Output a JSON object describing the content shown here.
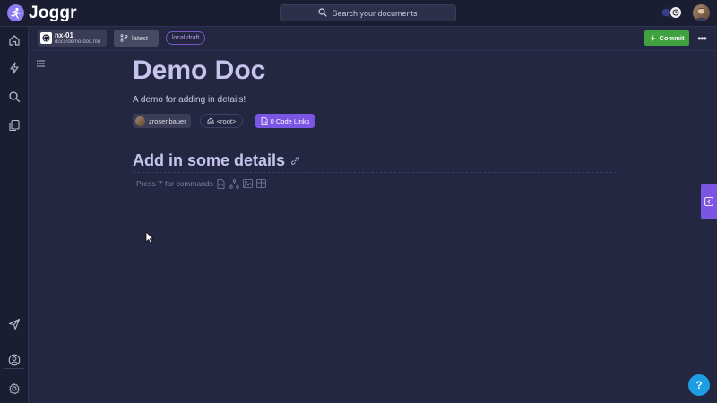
{
  "app": {
    "name": "Joggr"
  },
  "search": {
    "placeholder": "Search your documents"
  },
  "sidebar": {
    "icons": [
      "home-icon",
      "bolt-icon",
      "search-icon",
      "documents-icon",
      "send-icon",
      "user-icon",
      "gear-icon"
    ]
  },
  "docbar": {
    "repo_name": "nx-01",
    "repo_path": "docs/demo-doc.md",
    "branch_label": "latest",
    "draft_label": "local draft",
    "commit_label": "Commit",
    "more_label": "•••"
  },
  "document": {
    "title": "Demo Doc",
    "description": "A demo for adding in details!",
    "author": "zrosenbauer",
    "root_label": "<root>",
    "code_links_label": "0 Code Links",
    "heading": "Add in some details",
    "command_hint": "Press '/' for commands"
  },
  "help": {
    "label": "?"
  },
  "colors": {
    "accent": "#7b55e3",
    "commit": "#3fa23f",
    "help": "#1d9ee3",
    "background": "#242741",
    "sidebar": "#1b1d33"
  }
}
